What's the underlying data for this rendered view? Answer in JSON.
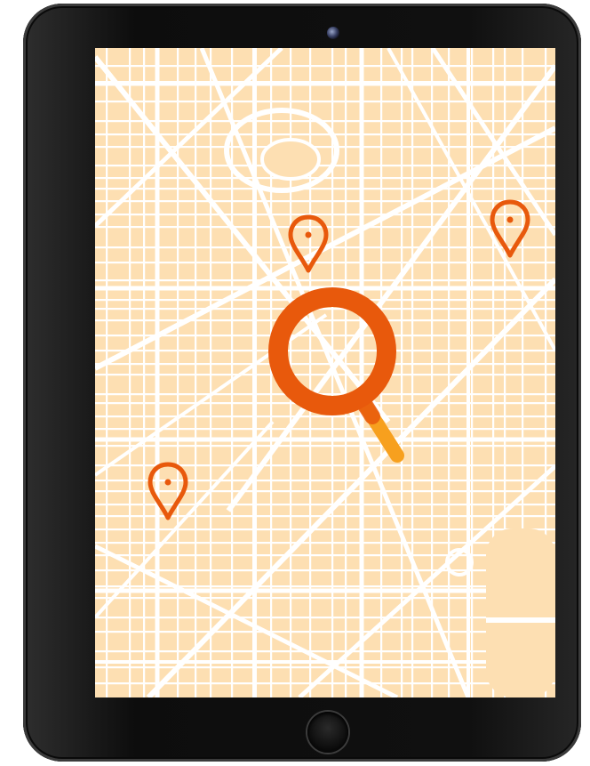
{
  "device": {
    "type": "tablet",
    "frame_color": "#111111",
    "screen": "city map"
  },
  "map": {
    "block_color": "#FDDFB2",
    "road_color": "#FFFFFF",
    "accent_color": "#E8590C",
    "accent_light_color": "#F7A01E",
    "markers": [
      {
        "name": "location-pin-icon",
        "color": "#E8590C"
      },
      {
        "name": "location-pin-icon",
        "color": "#E8590C"
      },
      {
        "name": "location-pin-icon",
        "color": "#E8590C"
      }
    ],
    "search_icon": "magnifying-glass-icon"
  }
}
